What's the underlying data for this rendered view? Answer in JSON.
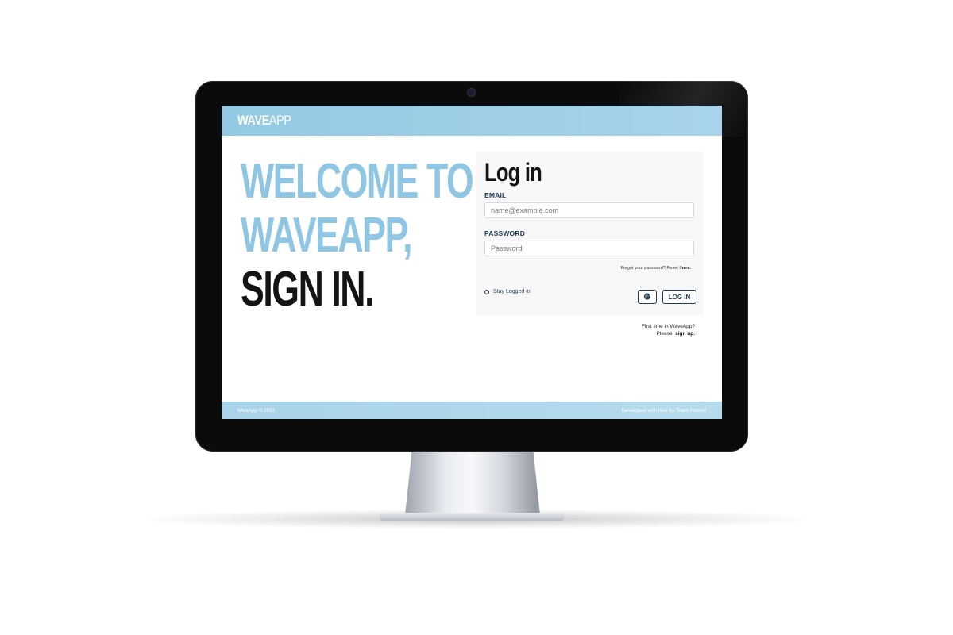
{
  "header": {
    "logo_bold": "WAVE",
    "logo_light": "APP"
  },
  "hero": {
    "line1": "WELCOME TO",
    "line2": "WAVEAPP,",
    "line3": "SIGN IN."
  },
  "login": {
    "title": "Log in",
    "email_label": "EMAIL",
    "email_placeholder": "name@example.com",
    "email_value": "",
    "password_label": "PASSWORD",
    "password_placeholder": "Password",
    "password_value": "",
    "forgot_text": "Forgot your password? Reset t",
    "forgot_link": "here.",
    "stay_logged_in_label": "Stay Logged in",
    "google_button_icon": "google-icon",
    "google_glyph": "G",
    "login_button_label": "LOG IN"
  },
  "signup": {
    "line1": "First time in WaveApp?",
    "line2_prefix": "Please, ",
    "link_label": "sign up."
  },
  "footer": {
    "left": "WebApp © 2021",
    "right": "Developed with love by Team Rocket"
  },
  "colors": {
    "accent_blue": "#8ec6e3",
    "dark_navy": "#1e3d52",
    "headline_black": "#141414"
  }
}
